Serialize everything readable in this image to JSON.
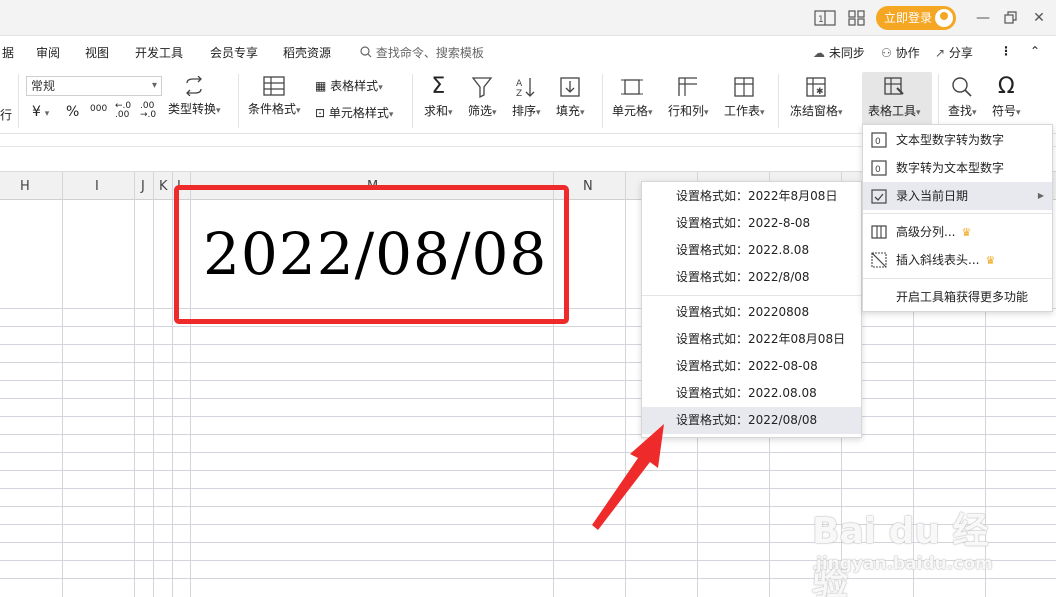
{
  "titlebar": {
    "login_label": "立即登录"
  },
  "menu": {
    "tabs": [
      "据",
      "审阅",
      "视图",
      "开发工具",
      "会员专享",
      "稻壳资源"
    ],
    "search_placeholder": "查找命令、搜索模板",
    "sync_label": "未同步",
    "collab_label": "协作",
    "share_label": "分享"
  },
  "ribbon": {
    "left_cut": "行",
    "format_combo": "常规",
    "currency_symbol": "¥",
    "percent_symbol": "%",
    "thousands_symbol": "000",
    "dec_inc": "←.0 .00",
    "dec_dec": ".00 →.0",
    "type_convert": "类型转换",
    "cond_format": "条件格式",
    "table_style": "表格样式",
    "cell_style": "单元格样式",
    "sum": "求和",
    "filter": "筛选",
    "sort": "排序",
    "fill": "填充",
    "cell": "单元格",
    "row_col": "行和列",
    "worksheet": "工作表",
    "freeze": "冻结窗格",
    "table_tools": "表格工具",
    "find": "查找",
    "symbol": "符号"
  },
  "sheet": {
    "columns": [
      "H",
      "I",
      "J",
      "K",
      "L",
      "M",
      "N"
    ],
    "cell_value": "2022/08/08"
  },
  "submenu": {
    "items": [
      "设置格式如：2022年8月08日",
      "设置格式如：2022-8-08",
      "设置格式如：2022.8.08",
      "设置格式如：2022/8/08",
      "设置格式如：20220808",
      "设置格式如：2022年08月08日",
      "设置格式如：2022-08-08",
      "设置格式如：2022.08.08",
      "设置格式如：2022/08/08"
    ],
    "active_index": 8
  },
  "table_tools_menu": {
    "items": [
      "文本型数字转为数字",
      "数字转为文本型数字",
      "录入当前日期",
      "高级分列...",
      "插入斜线表头...",
      "开启工具箱获得更多功能"
    ],
    "active_index": 2
  },
  "watermark": {
    "brand": "Bai du 经验",
    "url": "jingyan.baidu.com"
  },
  "colors": {
    "accent_orange": "#f5a623",
    "highlight_red": "#ee2a2a",
    "menu_active_bg": "#e7e9ee"
  }
}
